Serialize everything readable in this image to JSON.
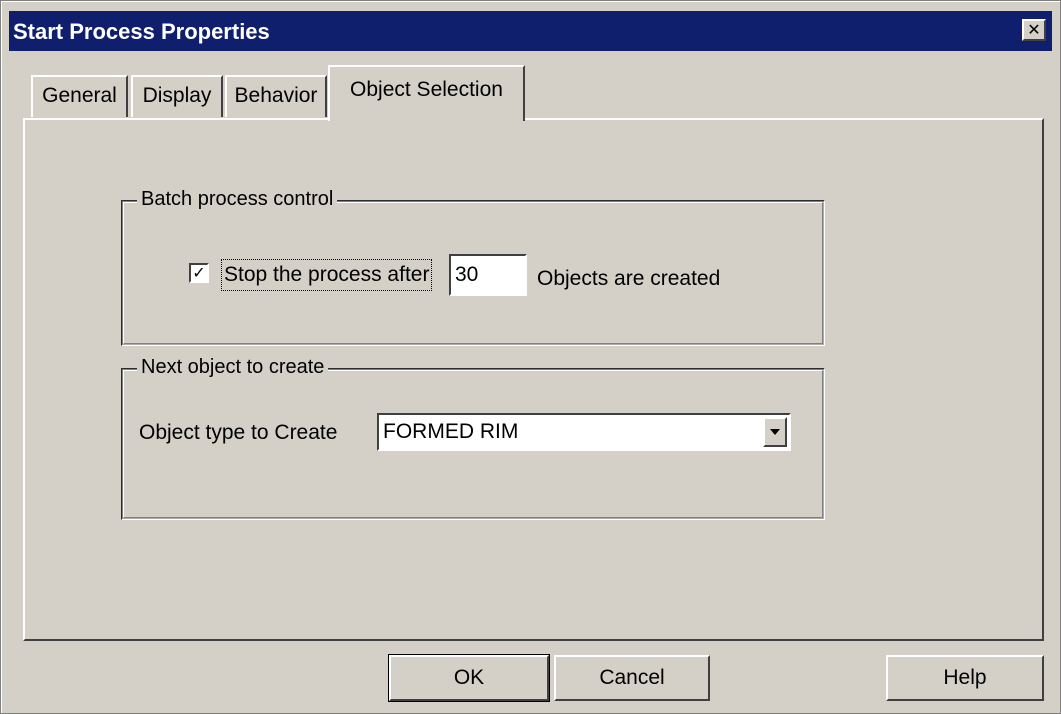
{
  "window": {
    "title": "Start Process Properties",
    "close_glyph": "✕",
    "title_bar_color": "#0f1f6e",
    "face_color": "#d4d0c8"
  },
  "tabs": [
    {
      "label": "General",
      "active": false
    },
    {
      "label": "Display",
      "active": false
    },
    {
      "label": "Behavior",
      "active": false
    },
    {
      "label": "Object Selection",
      "active": true
    }
  ],
  "batch_group": {
    "legend": "Batch process control",
    "checkbox_checked": true,
    "checkbox_glyph": "✓",
    "checkbox_label": "Stop the process after",
    "count_value": "30",
    "count_suffix": "Objects are created"
  },
  "next_group": {
    "legend": "Next object to create",
    "type_label": "Object type to Create",
    "type_value": "FORMED RIM",
    "dropdown_icon": "chevron-down-icon"
  },
  "buttons": {
    "ok": "OK",
    "cancel": "Cancel",
    "help": "Help"
  }
}
